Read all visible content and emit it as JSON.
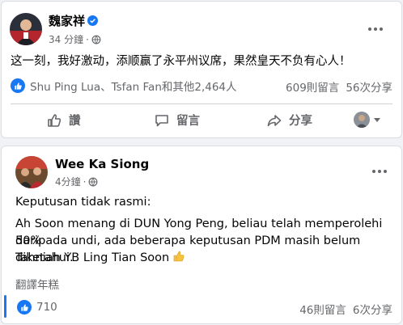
{
  "posts": [
    {
      "author": "魏家祥",
      "verified": true,
      "timestamp": "34 分鐘",
      "privacy_icon": "globe-icon",
      "text": "这一刻，我好激动，添顺赢了永平州议席，果然皇天不负有心人！",
      "reactors_text": "Shu Ping Lua、Tsfan Fan和其他2,464人",
      "comments": "609則留言",
      "shares": "56次分享",
      "actions": {
        "like": "讚",
        "comment": "留言",
        "share": "分享"
      }
    },
    {
      "author": "Wee Ka Siong",
      "timestamp": "4分鐘",
      "privacy_icon": "globe-icon",
      "text_lines": [
        "Keputusan tidak rasmi:",
        "Ah Soon menang di DUN Yong Peng, beliau telah memperolehi 50%",
        "daripada undi, ada beberapa keputusan PDM masih belum diketahui.",
        "Tahniah YB Ling Tian Soon"
      ],
      "translate_label": "翻譯年糕",
      "reaction_count": "710",
      "comments": "46則留言",
      "shares": "6次分享"
    }
  ],
  "colors": {
    "brand_blue": "#1877f2",
    "secondary_text": "#65676b",
    "background": "#f0f2f5"
  }
}
